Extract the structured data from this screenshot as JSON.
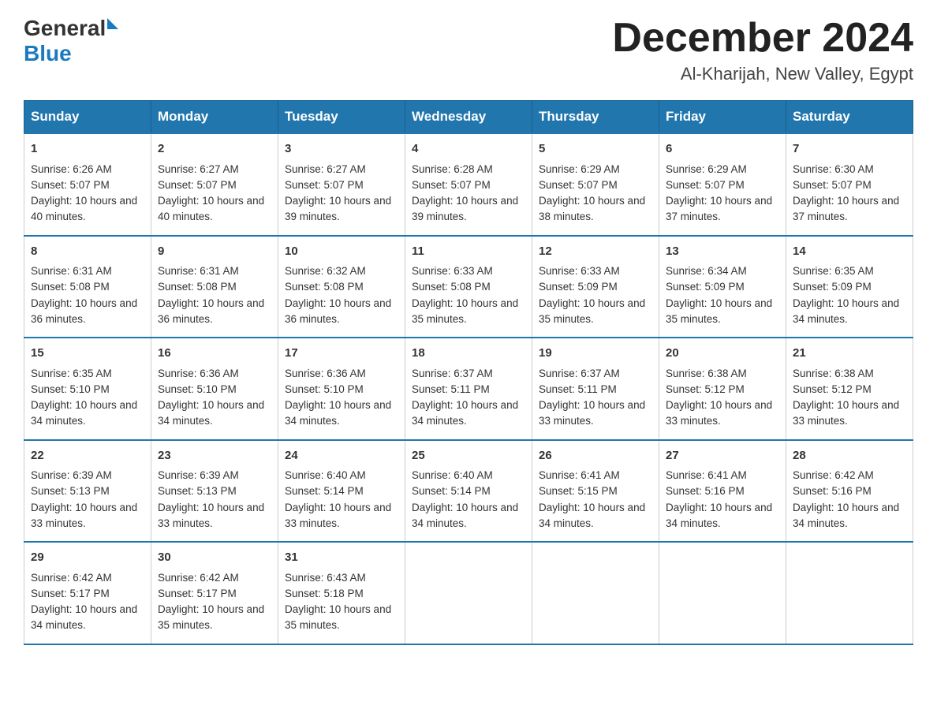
{
  "logo": {
    "text_general": "General",
    "triangle": "▶",
    "text_blue": "Blue"
  },
  "title": "December 2024",
  "subtitle": "Al-Kharijah, New Valley, Egypt",
  "days": [
    "Sunday",
    "Monday",
    "Tuesday",
    "Wednesday",
    "Thursday",
    "Friday",
    "Saturday"
  ],
  "weeks": [
    [
      {
        "num": "1",
        "sunrise": "6:26 AM",
        "sunset": "5:07 PM",
        "daylight": "10 hours and 40 minutes."
      },
      {
        "num": "2",
        "sunrise": "6:27 AM",
        "sunset": "5:07 PM",
        "daylight": "10 hours and 40 minutes."
      },
      {
        "num": "3",
        "sunrise": "6:27 AM",
        "sunset": "5:07 PM",
        "daylight": "10 hours and 39 minutes."
      },
      {
        "num": "4",
        "sunrise": "6:28 AM",
        "sunset": "5:07 PM",
        "daylight": "10 hours and 39 minutes."
      },
      {
        "num": "5",
        "sunrise": "6:29 AM",
        "sunset": "5:07 PM",
        "daylight": "10 hours and 38 minutes."
      },
      {
        "num": "6",
        "sunrise": "6:29 AM",
        "sunset": "5:07 PM",
        "daylight": "10 hours and 37 minutes."
      },
      {
        "num": "7",
        "sunrise": "6:30 AM",
        "sunset": "5:07 PM",
        "daylight": "10 hours and 37 minutes."
      }
    ],
    [
      {
        "num": "8",
        "sunrise": "6:31 AM",
        "sunset": "5:08 PM",
        "daylight": "10 hours and 36 minutes."
      },
      {
        "num": "9",
        "sunrise": "6:31 AM",
        "sunset": "5:08 PM",
        "daylight": "10 hours and 36 minutes."
      },
      {
        "num": "10",
        "sunrise": "6:32 AM",
        "sunset": "5:08 PM",
        "daylight": "10 hours and 36 minutes."
      },
      {
        "num": "11",
        "sunrise": "6:33 AM",
        "sunset": "5:08 PM",
        "daylight": "10 hours and 35 minutes."
      },
      {
        "num": "12",
        "sunrise": "6:33 AM",
        "sunset": "5:09 PM",
        "daylight": "10 hours and 35 minutes."
      },
      {
        "num": "13",
        "sunrise": "6:34 AM",
        "sunset": "5:09 PM",
        "daylight": "10 hours and 35 minutes."
      },
      {
        "num": "14",
        "sunrise": "6:35 AM",
        "sunset": "5:09 PM",
        "daylight": "10 hours and 34 minutes."
      }
    ],
    [
      {
        "num": "15",
        "sunrise": "6:35 AM",
        "sunset": "5:10 PM",
        "daylight": "10 hours and 34 minutes."
      },
      {
        "num": "16",
        "sunrise": "6:36 AM",
        "sunset": "5:10 PM",
        "daylight": "10 hours and 34 minutes."
      },
      {
        "num": "17",
        "sunrise": "6:36 AM",
        "sunset": "5:10 PM",
        "daylight": "10 hours and 34 minutes."
      },
      {
        "num": "18",
        "sunrise": "6:37 AM",
        "sunset": "5:11 PM",
        "daylight": "10 hours and 34 minutes."
      },
      {
        "num": "19",
        "sunrise": "6:37 AM",
        "sunset": "5:11 PM",
        "daylight": "10 hours and 33 minutes."
      },
      {
        "num": "20",
        "sunrise": "6:38 AM",
        "sunset": "5:12 PM",
        "daylight": "10 hours and 33 minutes."
      },
      {
        "num": "21",
        "sunrise": "6:38 AM",
        "sunset": "5:12 PM",
        "daylight": "10 hours and 33 minutes."
      }
    ],
    [
      {
        "num": "22",
        "sunrise": "6:39 AM",
        "sunset": "5:13 PM",
        "daylight": "10 hours and 33 minutes."
      },
      {
        "num": "23",
        "sunrise": "6:39 AM",
        "sunset": "5:13 PM",
        "daylight": "10 hours and 33 minutes."
      },
      {
        "num": "24",
        "sunrise": "6:40 AM",
        "sunset": "5:14 PM",
        "daylight": "10 hours and 33 minutes."
      },
      {
        "num": "25",
        "sunrise": "6:40 AM",
        "sunset": "5:14 PM",
        "daylight": "10 hours and 34 minutes."
      },
      {
        "num": "26",
        "sunrise": "6:41 AM",
        "sunset": "5:15 PM",
        "daylight": "10 hours and 34 minutes."
      },
      {
        "num": "27",
        "sunrise": "6:41 AM",
        "sunset": "5:16 PM",
        "daylight": "10 hours and 34 minutes."
      },
      {
        "num": "28",
        "sunrise": "6:42 AM",
        "sunset": "5:16 PM",
        "daylight": "10 hours and 34 minutes."
      }
    ],
    [
      {
        "num": "29",
        "sunrise": "6:42 AM",
        "sunset": "5:17 PM",
        "daylight": "10 hours and 34 minutes."
      },
      {
        "num": "30",
        "sunrise": "6:42 AM",
        "sunset": "5:17 PM",
        "daylight": "10 hours and 35 minutes."
      },
      {
        "num": "31",
        "sunrise": "6:43 AM",
        "sunset": "5:18 PM",
        "daylight": "10 hours and 35 minutes."
      },
      null,
      null,
      null,
      null
    ]
  ],
  "labels": {
    "sunrise_prefix": "Sunrise: ",
    "sunset_prefix": "Sunset: ",
    "daylight_prefix": "Daylight: "
  }
}
